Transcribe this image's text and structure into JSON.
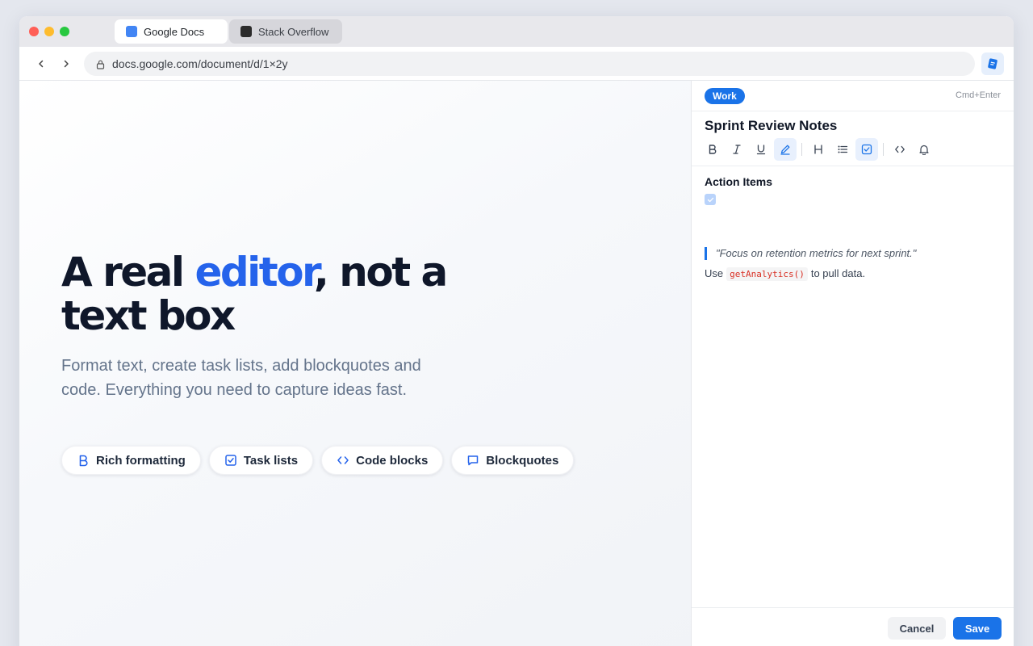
{
  "browser": {
    "tabs": [
      {
        "label": "Google Docs",
        "icon": "google-docs-icon",
        "active": true
      },
      {
        "label": "Stack Overflow",
        "icon": "stack-overflow-icon",
        "active": false
      }
    ],
    "url": "docs.google.com/document/d/1×2y",
    "extension_icon": "doc-extension-icon"
  },
  "hero": {
    "title_part1": "A real ",
    "title_accent": "editor",
    "title_part2": ", not a text box",
    "subtitle": "Format text, create task lists, add blockquotes and code. Everything you need to capture ideas fast.",
    "chips": [
      {
        "label": "Rich formatting",
        "icon": "bold-icon"
      },
      {
        "label": "Task lists",
        "icon": "checkbox-icon"
      },
      {
        "label": "Code blocks",
        "icon": "code-icon"
      },
      {
        "label": "Blockquotes",
        "icon": "comment-icon"
      }
    ]
  },
  "panel": {
    "tag": "Work",
    "shortcut": "Cmd+Enter",
    "title": "Sprint Review Notes",
    "toolbar": [
      "bold",
      "italic",
      "underline",
      "highlight",
      "heading",
      "bullet-list",
      "task-list",
      "code",
      "reminder"
    ],
    "active_tools": [
      "highlight",
      "task-list"
    ],
    "section_heading": "Action Items",
    "checkbox_checked": true,
    "quote": "\"Focus on retention metrics for next sprint.\"",
    "code_line": {
      "before": "Use",
      "code": "getAnalytics()",
      "after": "to pull data."
    },
    "cancel_label": "Cancel",
    "save_label": "Save"
  },
  "colors": {
    "accent": "#2563eb",
    "primary_button": "#1a73e8",
    "code_text": "#d93025"
  }
}
